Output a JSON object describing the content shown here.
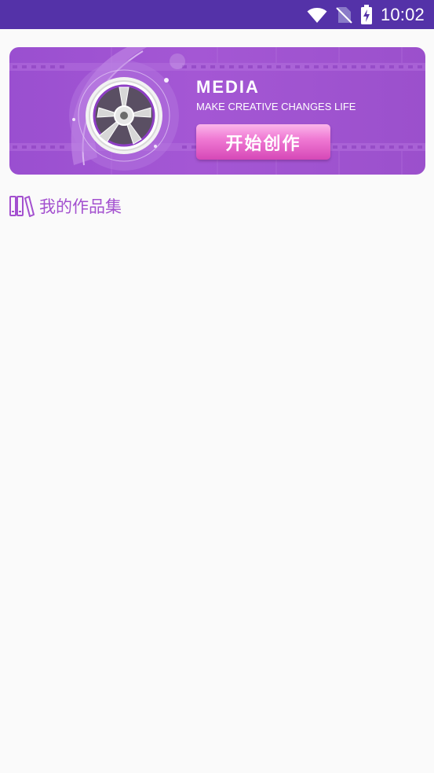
{
  "status_bar": {
    "time": "10:02",
    "icons": [
      "wifi-icon",
      "no-sim-icon",
      "battery-charging-icon"
    ],
    "background": "#5432a8"
  },
  "banner": {
    "title": "MEDIA",
    "subtitle": "MAKE CREATIVE CHANGES LIFE",
    "button_label": "开始创作",
    "icon": "film-reel-icon",
    "background": "#a054d2"
  },
  "section": {
    "title": "我的作品集",
    "icon": "books-icon",
    "accent": "#a350cf"
  }
}
